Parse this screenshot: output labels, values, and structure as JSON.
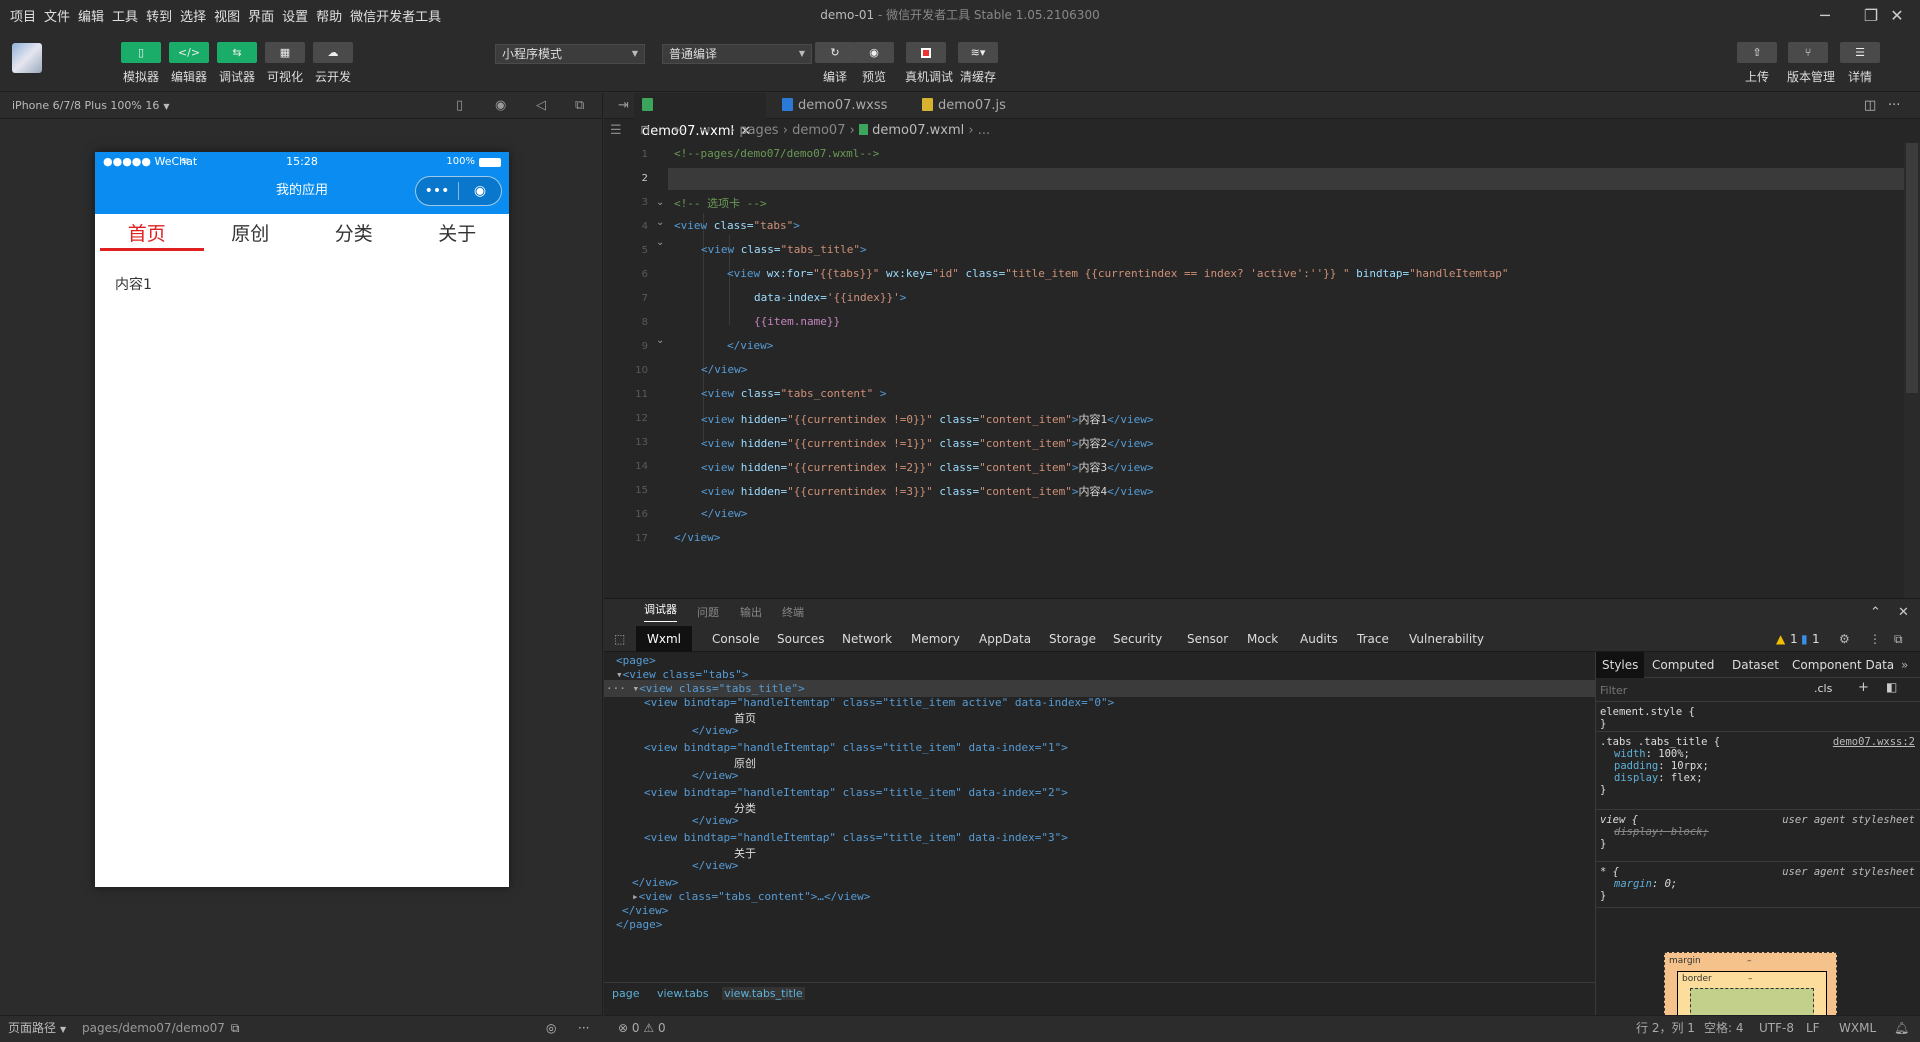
{
  "menu": [
    "项目",
    "文件",
    "编辑",
    "工具",
    "转到",
    "选择",
    "视图",
    "界面",
    "设置",
    "帮助",
    "微信开发者工具"
  ],
  "window_title": {
    "project": "demo-01",
    "app": " - 微信开发者工具 Stable 1.05.2106300"
  },
  "toolbar": {
    "left_buttons": [
      {
        "label": "模拟器",
        "icon": "phone-icon"
      },
      {
        "label": "编辑器",
        "icon": "code-icon"
      },
      {
        "label": "调试器",
        "icon": "debug-icon"
      },
      {
        "label": "可视化",
        "icon": "layout-icon"
      },
      {
        "label": "云开发",
        "icon": "cloud-icon"
      }
    ],
    "mode_select": "小程序模式",
    "compile_select": "普通编译",
    "mid_buttons": [
      {
        "label": "编译",
        "icon": "refresh-icon"
      },
      {
        "label": "预览",
        "icon": "eye-icon"
      },
      {
        "label": "真机调试",
        "icon": "device-icon"
      },
      {
        "label": "清缓存",
        "icon": "layers-icon"
      }
    ],
    "right_buttons": [
      {
        "label": "上传",
        "icon": "upload-icon"
      },
      {
        "label": "版本管理",
        "icon": "branch-icon"
      },
      {
        "label": "详情",
        "icon": "menu-icon"
      }
    ],
    "colors": {
      "active_button": "#1aad6a"
    }
  },
  "simulator": {
    "device": "iPhone 6/7/8 Plus 100% 16",
    "status": {
      "carrier": "●●●●● WeChat",
      "time": "15:28",
      "battery": "100%"
    },
    "nav_title": "我的应用",
    "tabs": [
      "首页",
      "原创",
      "分类",
      "关于"
    ],
    "active_tab": 0,
    "content": "内容1",
    "colors": {
      "nav": "#0a8cf0",
      "active_tab": "#e02020"
    }
  },
  "sim_footer": {
    "label": "页面路径",
    "path": "pages/demo07/demo07"
  },
  "editor": {
    "tabs": [
      {
        "name": "demo07.wxml",
        "active": true
      },
      {
        "name": "demo07.wxss",
        "active": false
      },
      {
        "name": "demo07.js",
        "active": false
      }
    ],
    "breadcrumb": [
      "pages",
      "demo07",
      "demo07.wxml",
      "..."
    ],
    "current_line": 2,
    "line_numbers": [
      "1",
      "2",
      "3",
      "4",
      "5",
      "6",
      "7",
      "8",
      "9",
      "10",
      "11",
      "12",
      "13",
      "14",
      "15",
      "16",
      "17"
    ],
    "code": {
      "l1": "<!--pages/demo07/demo07.wxml-->",
      "l3": "<!-- 选项卡 -->",
      "l4a": "<view",
      "l4b": " class=",
      "l4c": "\"tabs\"",
      "l4d": ">",
      "l5a": "<view",
      "l5b": " class=",
      "l5c": "\"tabs_title\"",
      "l5d": ">",
      "l6a": "<view",
      "l6b": " wx:for=",
      "l6c": "\"{{tabs}}\"",
      "l6d": " wx:key=",
      "l6e": "\"id\"",
      "l6f": " class=",
      "l6g": "\"title_item {{currentindex == index? 'active':''}} \"",
      "l6h": " bindtap=",
      "l6i": "\"handleItemtap\"",
      "l7a": "data-index=",
      "l7b": "'{{index}}'",
      "l7c": ">",
      "l8": "{{item.name}}",
      "l9": "</view>",
      "l10": "</view>",
      "l11a": "<view",
      "l11b": " class=",
      "l11c": "\"tabs_content\"",
      "l11d": " >",
      "l12": {
        "a": "<view",
        "b": " hidden=",
        "c": "\"{{currentindex !=0}}\"",
        "d": " class=",
        "e": "\"content_item\"",
        "f": ">",
        "g": "内容1",
        "h": "</view>"
      },
      "l13": {
        "a": "<view",
        "b": " hidden=",
        "c": "\"{{currentindex !=1}}\"",
        "d": " class=",
        "e": "\"content_item\"",
        "f": ">",
        "g": "内容2",
        "h": "</view>"
      },
      "l14": {
        "a": "<view",
        "b": " hidden=",
        "c": "\"{{currentindex !=2}}\"",
        "d": " class=",
        "e": "\"content_item\"",
        "f": ">",
        "g": "内容3",
        "h": "</view>"
      },
      "l15": {
        "a": "<view",
        "b": " hidden=",
        "c": "\"{{currentindex !=3}}\"",
        "d": " class=",
        "e": "\"content_item\"",
        "f": ">",
        "g": "内容4",
        "h": "</view>"
      },
      "l16": "</view>",
      "l17": "</view>"
    }
  },
  "debugger": {
    "panel_tabs": [
      "调试器",
      "问题",
      "输出",
      "终端"
    ],
    "devtools_tabs": [
      "Wxml",
      "Console",
      "Sources",
      "Network",
      "Memory",
      "AppData",
      "Storage",
      "Security",
      "Sensor",
      "Mock",
      "Audits",
      "Trace",
      "Vulnerability"
    ],
    "warnings": "1",
    "infos": "1",
    "wxml_tree": {
      "page_open": "<page>",
      "tabs_open": "<view class=\"tabs\">",
      "title_open": "<view class=\"tabs_title\">",
      "items": [
        {
          "open": "<view bindtap=\"handleItemtap\" class=\"title_item active\" data-index=\"0\">",
          "text": "首页",
          "close": "</view>"
        },
        {
          "open": "<view bindtap=\"handleItemtap\" class=\"title_item\" data-index=\"1\">",
          "text": "原创",
          "close": "</view>"
        },
        {
          "open": "<view bindtap=\"handleItemtap\" class=\"title_item\" data-index=\"2\">",
          "text": "分类",
          "close": "</view>"
        },
        {
          "open": "<view bindtap=\"handleItemtap\" class=\"title_item\" data-index=\"3\">",
          "text": "关于",
          "close": "</view>"
        }
      ],
      "title_close": "</view>",
      "content_collapsed": "<view class=\"tabs_content\">…</view>",
      "tabs_close": "</view>",
      "page_close": "</page>"
    },
    "dom_breadcrumb": [
      "page",
      "view.tabs",
      "view.tabs_title"
    ],
    "styles_tabs": [
      "Styles",
      "Computed",
      "Dataset",
      "Component Data"
    ],
    "filter_placeholder": "Filter",
    "cls_label": ".cls",
    "rules": {
      "element_style": "element.style {",
      "close": "}",
      "tabs_selector": ".tabs .tabs_title {",
      "tabs_source": "demo07.wxss:2",
      "width_prop": "width",
      "width_val": "100%;",
      "padding_prop": "padding",
      "padding_val": "10rpx;",
      "display_prop": "display",
      "display_val": "flex;",
      "view_selector": "view {",
      "ua_label": "user agent stylesheet",
      "view_prop": "display: block;",
      "star_selector": "* {",
      "margin_prop": "margin",
      "margin_val": "0;"
    },
    "box_model": {
      "margin_label": "margin",
      "margin_val": "–",
      "border_label": "border",
      "border_val": "–"
    }
  },
  "statusbar": {
    "errors": "0",
    "warnings": "0",
    "position": "行 2，列 1",
    "indent": "空格: 4",
    "encoding": "UTF-8",
    "eol": "LF",
    "language": "WXML"
  }
}
